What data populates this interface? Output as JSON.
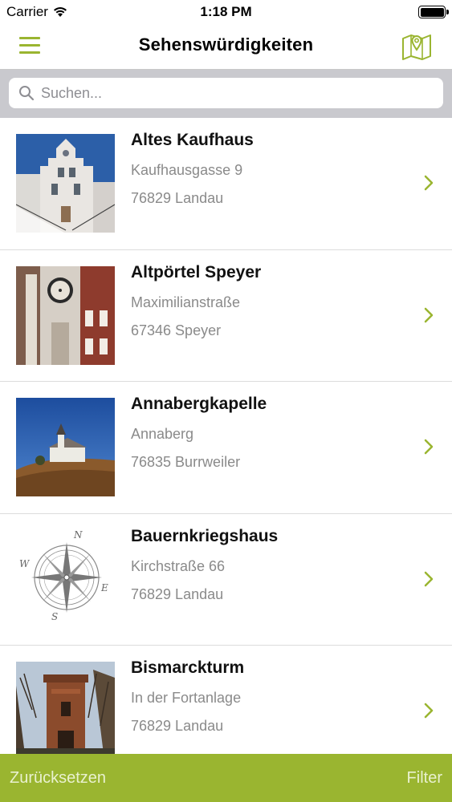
{
  "status_bar": {
    "carrier": "Carrier",
    "time": "1:18 PM",
    "icons": [
      "wifi-icon",
      "battery-icon"
    ]
  },
  "nav": {
    "title": "Sehenswürdigkeiten",
    "left_icon": "menu-icon",
    "right_icon": "map-pin-icon"
  },
  "search": {
    "placeholder": "Suchen...",
    "value": "",
    "icon": "search-icon"
  },
  "items": [
    {
      "title": "Altes Kaufhaus",
      "street": "Kaufhausgasse 9",
      "city": "76829 Landau"
    },
    {
      "title": "Altpörtel Speyer",
      "street": "Maximilianstraße",
      "city": "67346 Speyer"
    },
    {
      "title": "Annabergkapelle",
      "street": "Annaberg",
      "city": "76835 Burrweiler"
    },
    {
      "title": "Bauernkriegshaus",
      "street": "Kirchstraße 66",
      "city": "76829 Landau"
    },
    {
      "title": "Bismarckturm",
      "street": "In der Fortanlage",
      "city": "76829 Landau"
    }
  ],
  "compass_letters": {
    "n": "N",
    "e": "E",
    "s": "S",
    "w": "W"
  },
  "bottom_bar": {
    "reset_label": "Zurücksetzen",
    "filter_label": "Filter"
  },
  "colors": {
    "accent": "#9ab530",
    "bottom_text": "#e9f1cf",
    "secondary_text": "#8a8a8a",
    "search_bg": "#c9c9ce"
  }
}
